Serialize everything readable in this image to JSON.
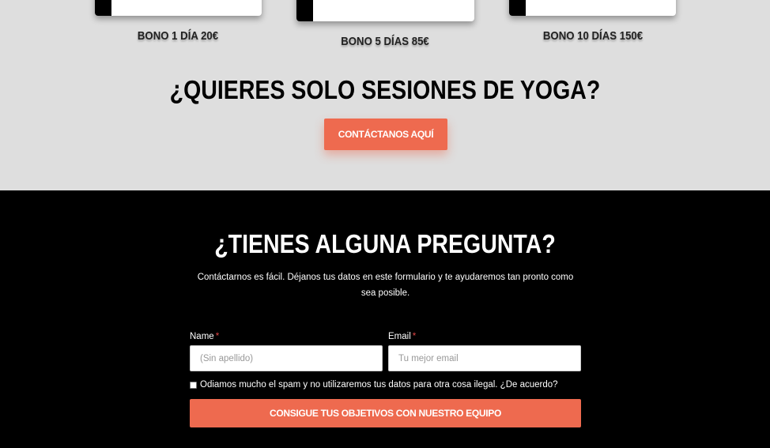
{
  "pricing": {
    "cards": [
      {
        "label": "BONO 1 DÍA 20€"
      },
      {
        "label": "BONO 5 DÍAS 85€"
      },
      {
        "label": "BONO 10 DÍAS 150€"
      }
    ]
  },
  "yoga": {
    "title": "¿QUIERES SOLO SESIONES DE YOGA?",
    "button_label": "CONTÁCTANOS AQUÍ"
  },
  "contact": {
    "title": "¿TIENES ALGUNA PREGUNTA?",
    "description_line1": "Contáctarnos es fácil. Déjanos tus datos en este formulario y te ayudaremos tan pronto como",
    "description_line2": "sea posible.",
    "name_label": "Name",
    "name_placeholder": "(Sin apellido)",
    "email_label": "Email",
    "email_placeholder": "Tu mejor email",
    "required_mark": "*",
    "consent_text": "Odiamos mucho el spam y no utilizaremos tus datos para otra cosa ilegal. ¿De acuerdo?",
    "submit_label": "CONSIGUE TUS OBJETIVOS CON NUESTRO EQUIPO"
  },
  "colors": {
    "accent": "#ee6a4f",
    "light_section": "#dedede",
    "dark_section": "#000000"
  }
}
